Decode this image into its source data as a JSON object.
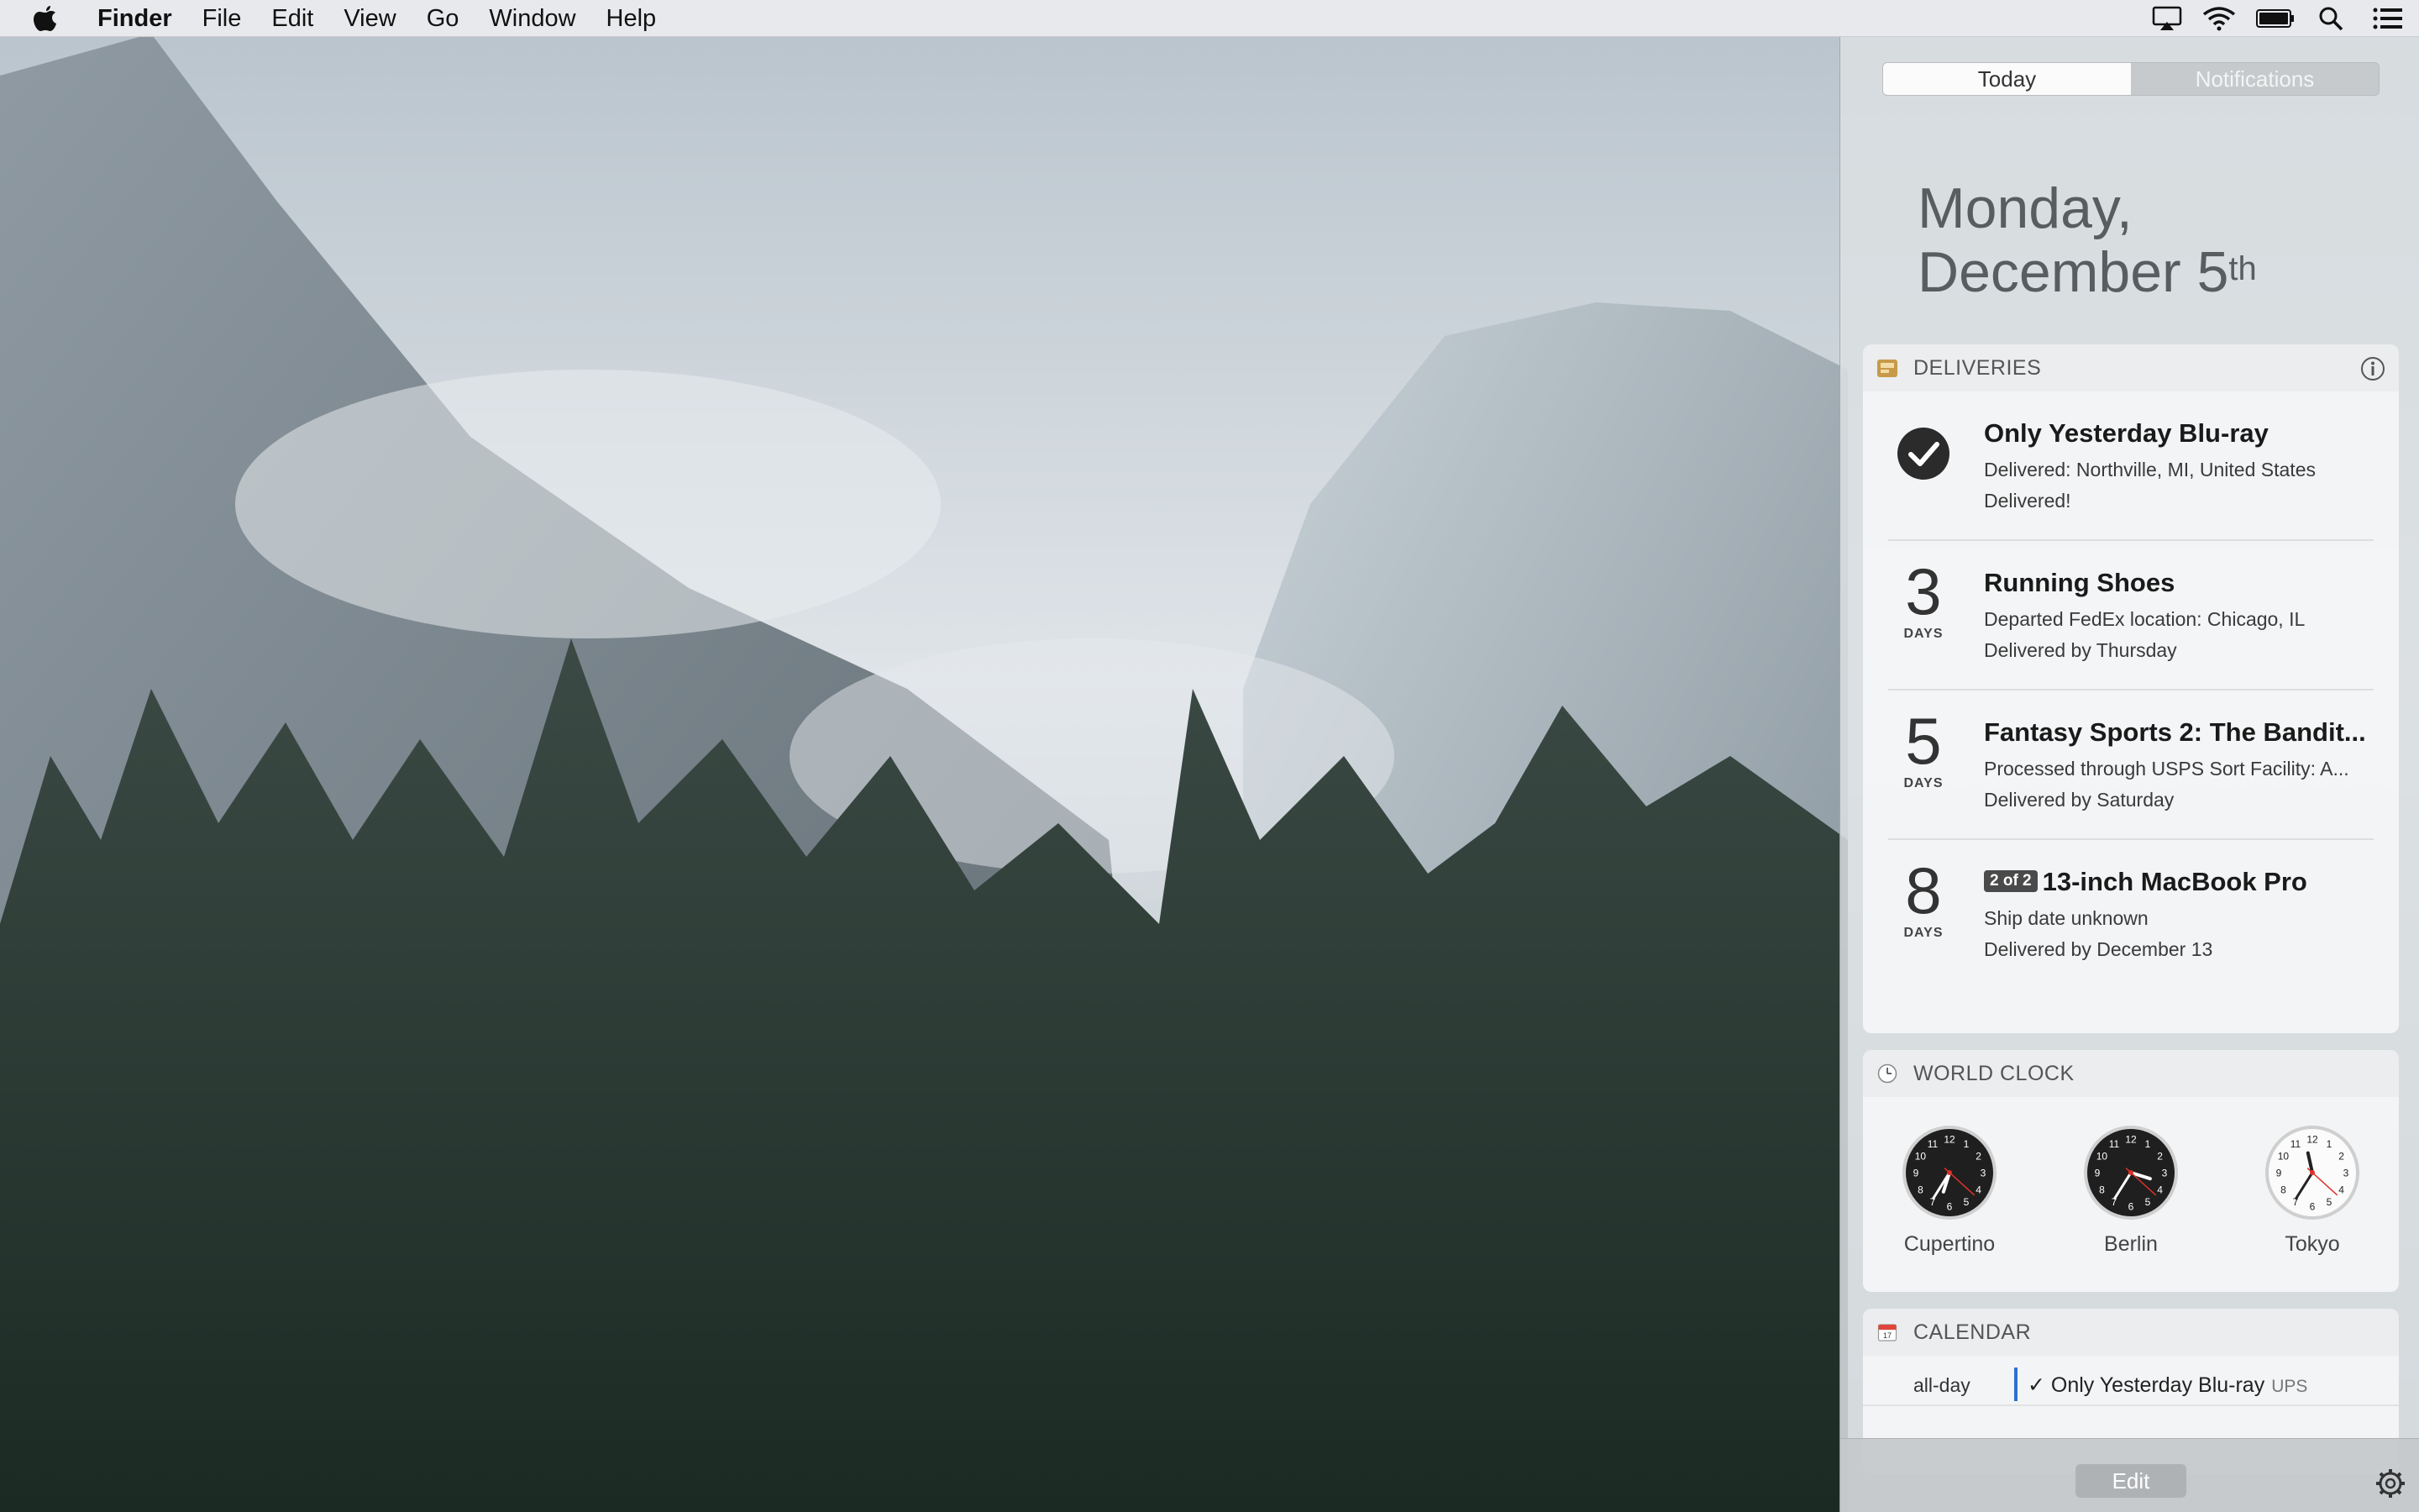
{
  "menubar": {
    "apple_icon": "apple-logo-icon",
    "app_name": "Finder",
    "items": [
      "File",
      "Edit",
      "View",
      "Go",
      "Window",
      "Help"
    ],
    "status_icons": [
      "airplay-icon",
      "wifi-icon",
      "battery-icon",
      "spotlight-search-icon",
      "notification-center-icon"
    ]
  },
  "notification_center": {
    "tabs": [
      {
        "label": "Today",
        "active": true
      },
      {
        "label": "Notifications",
        "active": false
      }
    ],
    "date": {
      "weekday": "Monday,",
      "month_day": "December 5",
      "suffix": "th"
    },
    "deliveries": {
      "title": "DELIVERIES",
      "icon": "deliveries-app-icon",
      "info_icon": "info-icon",
      "items": [
        {
          "status_icon": "checkmark-icon",
          "days": "",
          "days_label": "",
          "badge": "",
          "name": "Only Yesterday Blu-ray",
          "detail": "Delivered: Northville, MI, United States",
          "eta": "Delivered!"
        },
        {
          "days": "3",
          "days_label": "DAYS",
          "badge": "",
          "name": "Running Shoes",
          "detail": "Departed FedEx location: Chicago, IL",
          "eta": "Delivered by Thursday"
        },
        {
          "days": "5",
          "days_label": "DAYS",
          "badge": "",
          "name": "Fantasy Sports 2: The Bandit...",
          "detail": "Processed through USPS Sort Facility: A...",
          "eta": "Delivered by Saturday"
        },
        {
          "days": "8",
          "days_label": "DAYS",
          "badge": "2 of 2",
          "name": "13-inch MacBook Pro",
          "detail": "Ship date unknown",
          "eta": "Delivered by December 13"
        }
      ]
    },
    "world_clock": {
      "title": "WORLD CLOCK",
      "icon": "clock-icon",
      "clocks": [
        {
          "city": "Cupertino",
          "face": "dark",
          "hour": 6,
          "minute": 35,
          "second": 22
        },
        {
          "city": "Berlin",
          "face": "dark",
          "hour": 3,
          "minute": 35,
          "second": 22
        },
        {
          "city": "Tokyo",
          "face": "light",
          "hour": 11,
          "minute": 35,
          "second": 22
        }
      ]
    },
    "calendar": {
      "title": "CALENDAR",
      "icon": "calendar-icon",
      "events": [
        {
          "time": "all-day",
          "check": "✓",
          "title": "Only Yesterday Blu-ray",
          "location": "UPS",
          "color": "#2f6fd1"
        }
      ]
    },
    "bottom": {
      "edit_label": "Edit",
      "settings_icon": "gear-icon"
    }
  }
}
